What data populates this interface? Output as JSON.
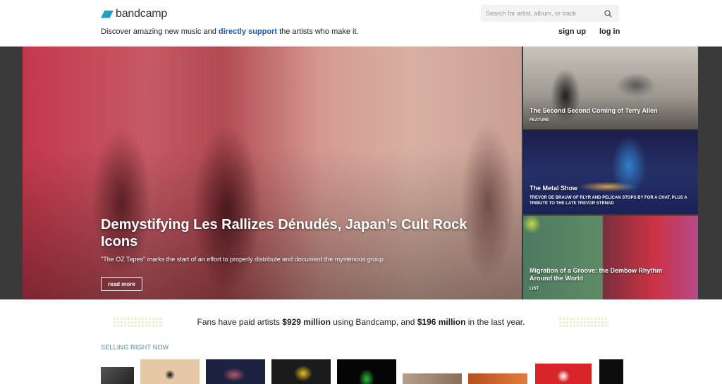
{
  "header": {
    "logo_text": "bandcamp",
    "tagline_pre": "Discover amazing new music and ",
    "tagline_accent": "directly support",
    "tagline_post": " the artists who make it.",
    "search_placeholder": "Search for artist, album, or track",
    "signup_label": "sign up",
    "login_label": "log in"
  },
  "hero": {
    "title": "Demystifying Les Rallizes Dénudés, Japan’s Cult Rock Icons",
    "description": "\"The OZ Tapes\" marks the start of an effort to properly distribute and document the mysterious group.",
    "read_more_label": "read more"
  },
  "side_features": [
    {
      "title": "The Second Second Coming of Terry Allen",
      "subtitle": "FEATURE"
    },
    {
      "title": "The Metal Show",
      "subtitle": "TREVOR DE BRAUW OF RLYR AND PELICAN STOPS BY FOR A CHAT, PLUS A TRIBUTE TO THE LATE TREVOR STRNAD"
    },
    {
      "title": "Migration of a Groove: the Dembow Rhythm Around the World",
      "subtitle": "LIST"
    }
  ],
  "stats": {
    "pre": "Fans have paid artists ",
    "total": "$929 million",
    "mid": " using Bandcamp, and ",
    "year": "$196 million",
    "post": " in the last year."
  },
  "selling": {
    "label": "SELLING RIGHT NOW"
  },
  "colors": {
    "accent_link": "#1a5cb5",
    "section_label": "#4a8fb5",
    "logo": "#1da0c3"
  }
}
